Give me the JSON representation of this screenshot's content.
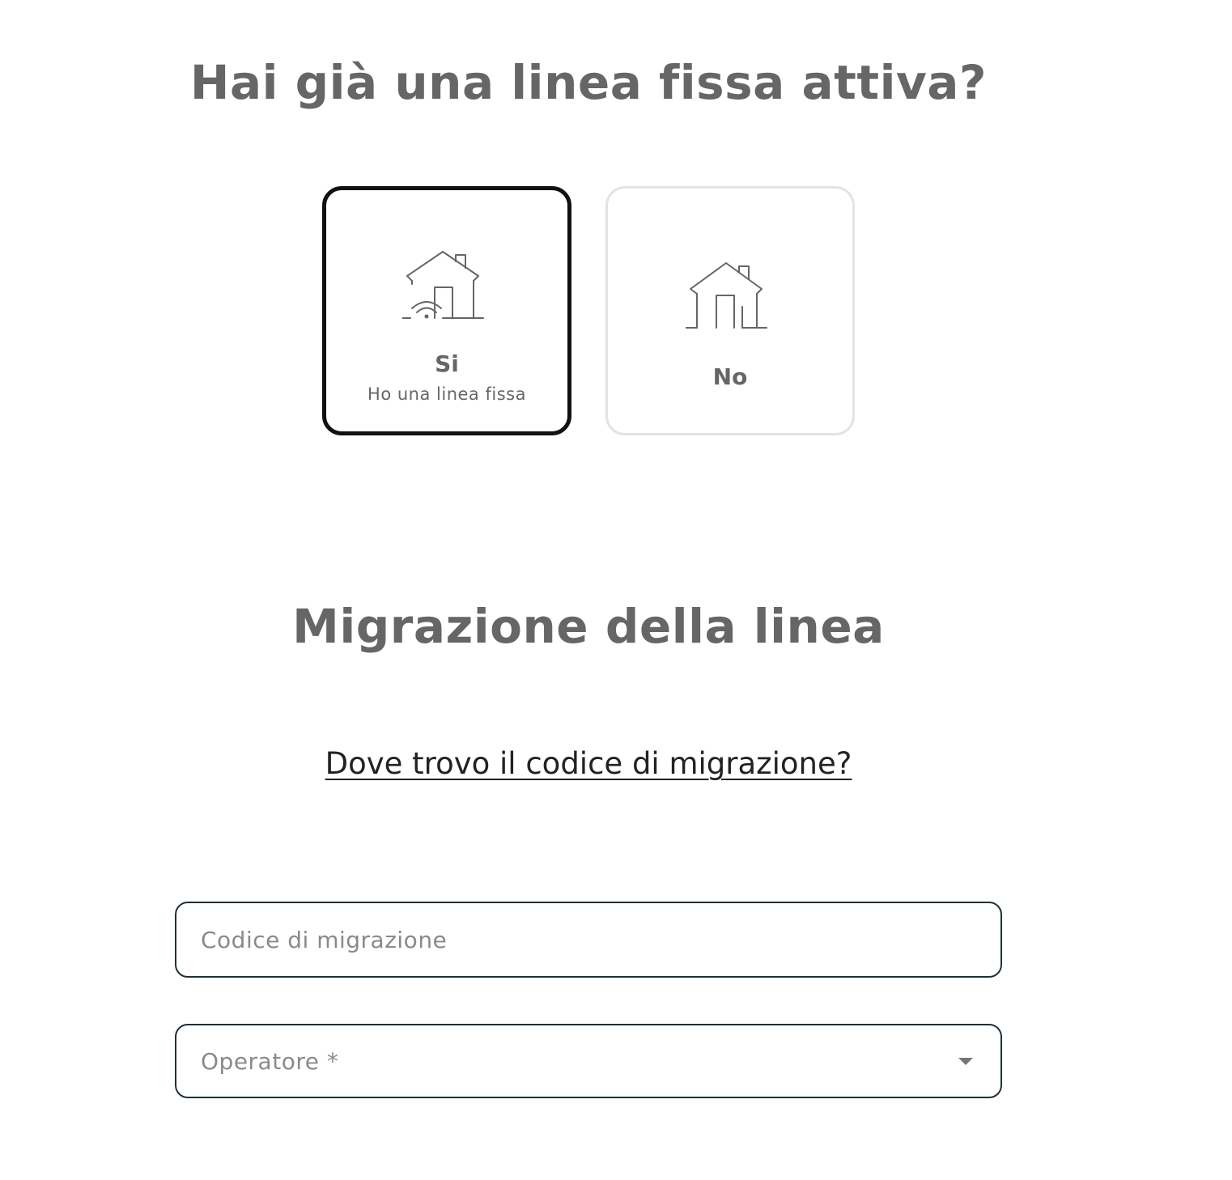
{
  "question": {
    "title": "Hai già una linea fissa attiva?"
  },
  "options": [
    {
      "label": "Si",
      "sublabel": "Ho una linea fissa",
      "icon": "house-wifi-icon",
      "selected": true
    },
    {
      "label": "No",
      "sublabel": "",
      "icon": "house-icon",
      "selected": false
    }
  ],
  "migration": {
    "title": "Migrazione della linea",
    "help_link": "Dove trovo il codice di migrazione?",
    "code_field": {
      "placeholder": "Codice di migrazione",
      "value": ""
    },
    "operator_field": {
      "placeholder": "Operatore *",
      "value": ""
    }
  },
  "colors": {
    "text": "#666666",
    "selected_border": "#111111",
    "unselected_border": "#e3e3e3",
    "field_border": "#1f3038"
  }
}
